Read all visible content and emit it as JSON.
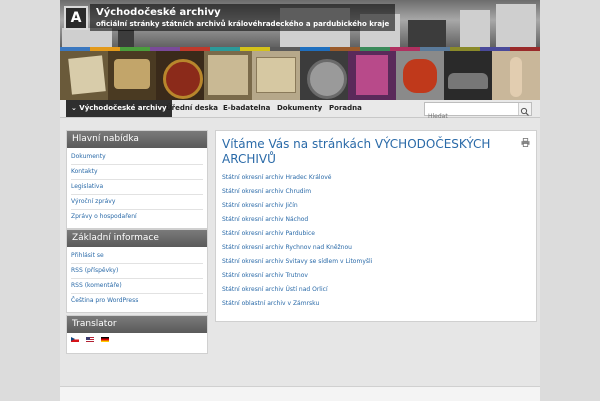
{
  "header": {
    "logo_letter": "A",
    "title": "Východočeské archivy",
    "subtitle": "oficiální stránky státních archivů královéhradeckého a pardubického kraje",
    "stripe_colors": [
      "#3b78c0",
      "#e39a1b",
      "#4a9e3c",
      "#7a4a9a",
      "#c0392b",
      "#2b9a9a",
      "#d4c21a",
      "#5a5a5a",
      "#1f6fbf",
      "#9a5a2a",
      "#3a8a5a",
      "#b03060",
      "#5a7a9a",
      "#8a8a2a",
      "#4a4a9a",
      "#9a2a2a"
    ]
  },
  "nav": {
    "items": [
      {
        "label": "⌄ Východočeské archivy",
        "active": true
      },
      {
        "label": "Úřední deska",
        "active": false
      },
      {
        "label": "E-badatelna",
        "active": false
      },
      {
        "label": "Dokumenty",
        "active": false
      },
      {
        "label": "Poradna",
        "active": false
      }
    ],
    "search_placeholder": "Hledat",
    "search_icon": "search-icon"
  },
  "sidebar": {
    "main_menu": {
      "title": "Hlavní nabídka",
      "items": [
        "Dokumenty",
        "Kontakty",
        "Legislativa",
        "Výroční zprávy",
        "Zprávy o hospodaření"
      ]
    },
    "basic_info": {
      "title": "Základní informace",
      "items": [
        "Přihlásit se",
        "RSS (příspěvky)",
        "RSS (komentáře)",
        "Čeština pro WordPress"
      ]
    },
    "translator": {
      "title": "Translator",
      "flags": [
        "czech-flag-icon",
        "english-flag-icon",
        "german-flag-icon"
      ]
    }
  },
  "main": {
    "heading": "Vítáme Vás na stránkách VÝCHODOČESKÝCH ARCHIVŮ",
    "print_icon": "print-icon",
    "links": [
      "Státní okresní archiv Hradec Králové",
      "Státní okresní archiv Chrudim",
      "Státní okresní archiv Jičín",
      "Státní okresní archiv Náchod",
      "Státní okresní archiv Pardubice",
      "Státní okresní archiv Rychnov nad Kněžnou",
      "Státní okresní archiv Svitavy se sídlem v Litomyšli",
      "Státní okresní archiv Trutnov",
      "Státní okresní archiv Ústí nad Orlicí",
      "Státní oblastní archiv v Zámrsku"
    ]
  },
  "colors": {
    "link": "#2a6aa8",
    "nav_active_bg": "#2f2f2f",
    "widget_header_bg": "#5a5a5a"
  }
}
